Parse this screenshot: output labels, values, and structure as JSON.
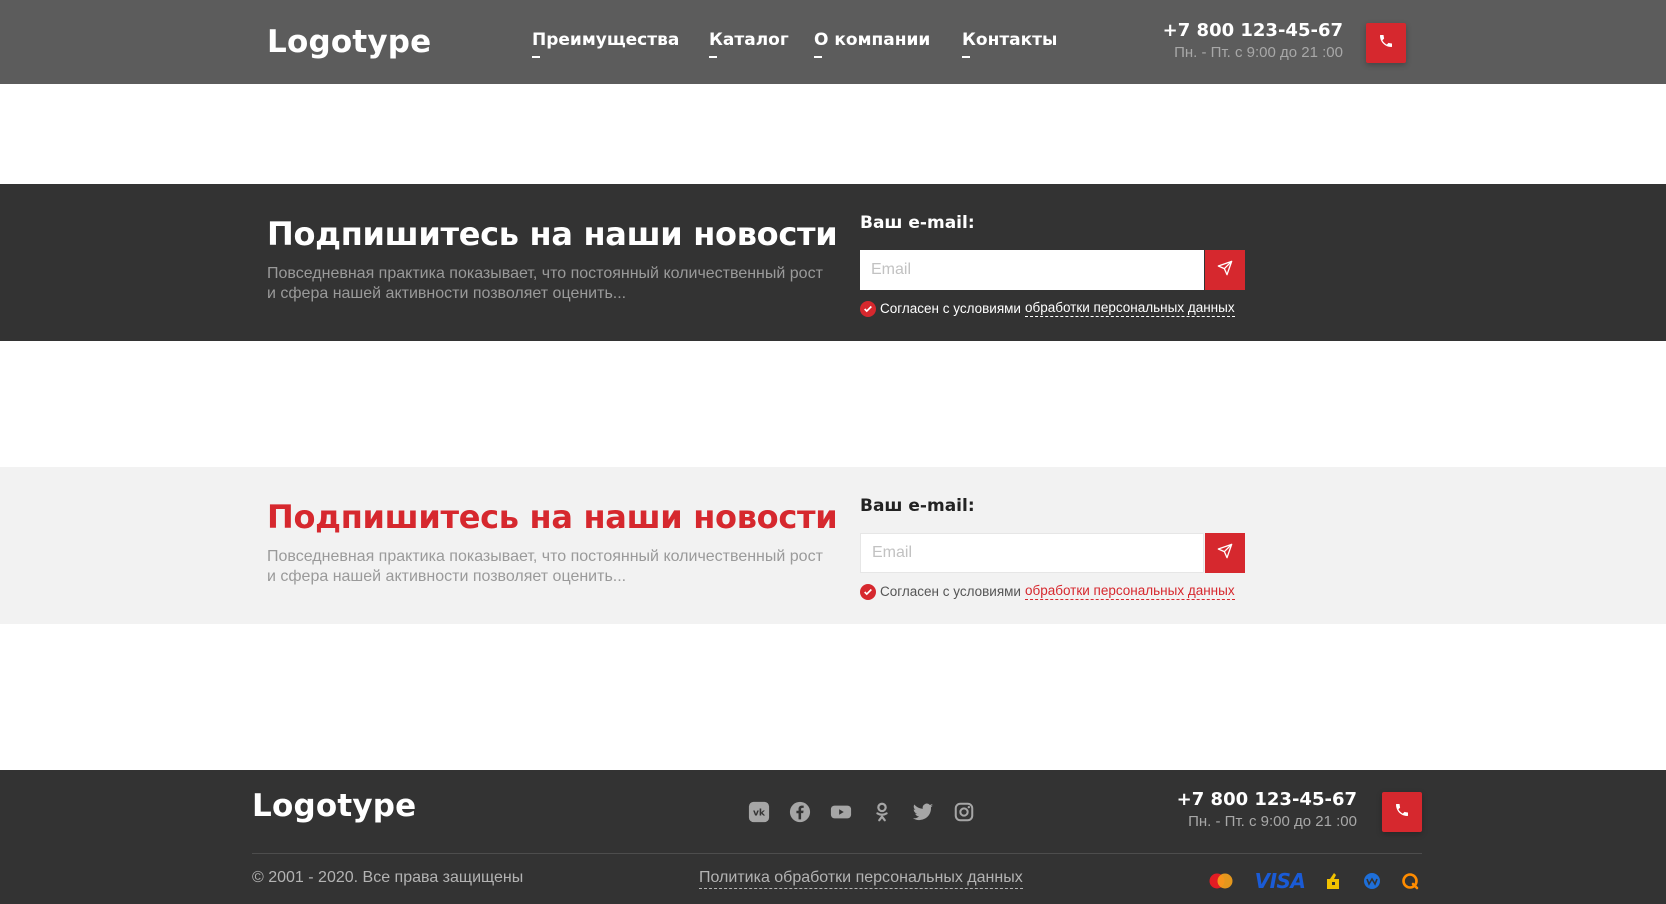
{
  "header": {
    "logo": "Logotype",
    "nav": [
      "Преимущества",
      "Каталог",
      "О компании",
      "Контакты"
    ],
    "phone": "+7 800 123-45-67",
    "hours": "Пн. - Пт. с 9:00 до 21 :00",
    "call_icon": "phone-icon"
  },
  "subscribe_dark": {
    "title": "Подпишитесь на наши новости",
    "description": "Повседневная практика показывает, что постоянный количественный рост и сфера нашей активности позволяет оценить...",
    "email_label": "Ваш e-mail:",
    "email_placeholder": "Email",
    "send_icon": "paper-plane-icon",
    "agree_text": "Согласен с условиями",
    "agree_link": "обработки персональных данных"
  },
  "subscribe_light": {
    "title": "Подпишитесь на наши новости",
    "description": "Повседневная практика показывает, что постоянный количественный рост и сфера нашей активности позволяет оценить...",
    "email_label": "Ваш e-mail:",
    "email_placeholder": "Email",
    "send_icon": "paper-plane-icon",
    "agree_text": "Согласен с условиями",
    "agree_link": "обработки персональных данных"
  },
  "footer": {
    "logo": "Logotype",
    "socials": [
      "vk-icon",
      "facebook-icon",
      "youtube-icon",
      "odnoklassniki-icon",
      "twitter-icon",
      "instagram-icon"
    ],
    "phone": "+7 800 123-45-67",
    "hours": "Пн. - Пт. с 9:00 до 21 :00",
    "copyright": "© 2001 - 2020. Все права защищены",
    "policy": "Политика обработки персональных данных",
    "payments": [
      "mastercard-icon",
      "visa-icon",
      "yandex-money-icon",
      "webmoney-icon",
      "qiwi-icon"
    ],
    "payment_text": {
      "visa": "VISA"
    }
  },
  "colors": {
    "accent": "#d6282e",
    "header_bg": "#5c5c5c",
    "dark_bg": "#333333",
    "light_bg": "#f2f2f2"
  }
}
